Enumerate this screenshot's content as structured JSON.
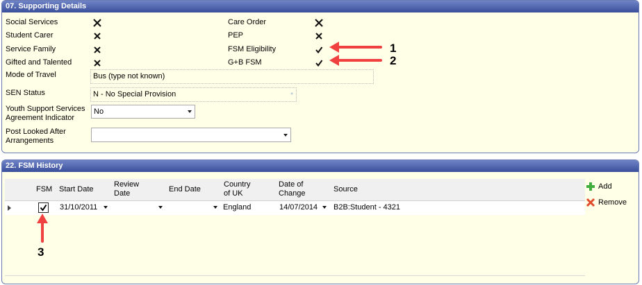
{
  "supporting": {
    "title": "07. Supporting Details",
    "left_items": [
      {
        "label": "Social Services",
        "state": "x"
      },
      {
        "label": "Student Carer",
        "state": "x"
      },
      {
        "label": "Service Family",
        "state": "x"
      },
      {
        "label": "Gifted and Talented",
        "state": "x"
      }
    ],
    "right_items": [
      {
        "label": "Care Order",
        "state": "x"
      },
      {
        "label": "PEP",
        "state": "x"
      },
      {
        "label": "FSM Eligibility",
        "state": "check"
      },
      {
        "label": "G+B FSM",
        "state": "check"
      }
    ],
    "mode_of_travel_label": "Mode of Travel",
    "mode_of_travel_value": "Bus (type not known)",
    "sen_status_label": "SEN Status",
    "sen_status_value": "N - No Special Provision",
    "youth_support_label_1": "Youth Support Services",
    "youth_support_label_2": "Agreement Indicator",
    "youth_support_value": "No",
    "post_looked_label_1": "Post Looked After",
    "post_looked_label_2": "Arrangements",
    "post_looked_value": ""
  },
  "fsm_history": {
    "title": "22. FSM History",
    "headers": {
      "fsm": "FSM",
      "start_date": "Start Date",
      "review_date_1": "Review",
      "review_date_2": "Date",
      "end_date": "End Date",
      "country_1": "Country",
      "country_2": "of UK",
      "date_change_1": "Date of",
      "date_change_2": "Change",
      "source": "Source"
    },
    "row": {
      "fsm": true,
      "start_date": "31/10/2011",
      "review_date": "",
      "end_date": "",
      "country": "England",
      "date_of_change": "14/07/2014",
      "source": "B2B:Student - 4321"
    },
    "add_label": "Add",
    "remove_label": "Remove"
  },
  "annotations": {
    "one": "1",
    "two": "2",
    "three": "3",
    "arrow_color": "#f04040"
  }
}
